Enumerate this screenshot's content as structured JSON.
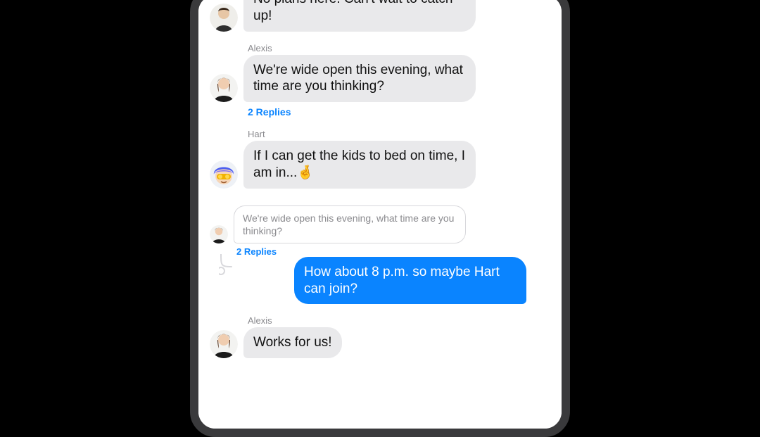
{
  "colors": {
    "outgoing_bubble": "#0a84ff",
    "incoming_bubble": "#e9e9eb",
    "link": "#0a84ff",
    "sender_label": "#8a8a8e",
    "quote_border": "#d8d8dc",
    "quote_text": "#8a8a8e"
  },
  "messages": {
    "m0": {
      "text": "No plans here. Can't wait to catch up!"
    },
    "m1": {
      "sender": "Alexis",
      "text": "We're wide open this evening, what time are you thinking?",
      "replies_label": "2 Replies"
    },
    "m2": {
      "sender": "Hart",
      "text": "If I can get the kids to bed on time, I am in...🤞"
    },
    "quote": {
      "text": "We're wide open this evening, what time are you thinking?",
      "replies_label": "2 Replies"
    },
    "m3": {
      "text": "How about 8 p.m. so maybe Hart can join?"
    },
    "m4": {
      "sender": "Alexis",
      "text": "Works for us!"
    }
  }
}
